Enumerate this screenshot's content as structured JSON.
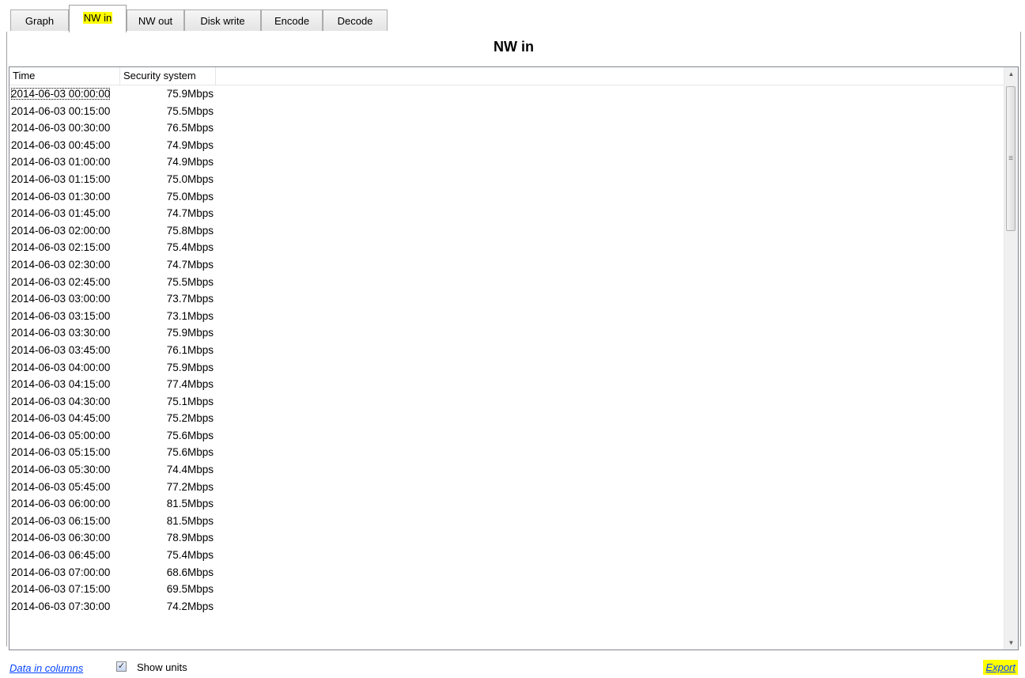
{
  "tabs": [
    {
      "label": "Graph"
    },
    {
      "label": "NW in"
    },
    {
      "label": "NW out"
    },
    {
      "label": "Disk write"
    },
    {
      "label": "Encode"
    },
    {
      "label": "Decode"
    }
  ],
  "active_tab": "NW in",
  "panel": {
    "title": "NW in"
  },
  "table": {
    "columns": [
      "Time",
      "Security system"
    ],
    "rows": [
      [
        "2014-06-03 00:00:00",
        "75.9Mbps"
      ],
      [
        "2014-06-03 00:15:00",
        "75.5Mbps"
      ],
      [
        "2014-06-03 00:30:00",
        "76.5Mbps"
      ],
      [
        "2014-06-03 00:45:00",
        "74.9Mbps"
      ],
      [
        "2014-06-03 01:00:00",
        "74.9Mbps"
      ],
      [
        "2014-06-03 01:15:00",
        "75.0Mbps"
      ],
      [
        "2014-06-03 01:30:00",
        "75.0Mbps"
      ],
      [
        "2014-06-03 01:45:00",
        "74.7Mbps"
      ],
      [
        "2014-06-03 02:00:00",
        "75.8Mbps"
      ],
      [
        "2014-06-03 02:15:00",
        "75.4Mbps"
      ],
      [
        "2014-06-03 02:30:00",
        "74.7Mbps"
      ],
      [
        "2014-06-03 02:45:00",
        "75.5Mbps"
      ],
      [
        "2014-06-03 03:00:00",
        "73.7Mbps"
      ],
      [
        "2014-06-03 03:15:00",
        "73.1Mbps"
      ],
      [
        "2014-06-03 03:30:00",
        "75.9Mbps"
      ],
      [
        "2014-06-03 03:45:00",
        "76.1Mbps"
      ],
      [
        "2014-06-03 04:00:00",
        "75.9Mbps"
      ],
      [
        "2014-06-03 04:15:00",
        "77.4Mbps"
      ],
      [
        "2014-06-03 04:30:00",
        "75.1Mbps"
      ],
      [
        "2014-06-03 04:45:00",
        "75.2Mbps"
      ],
      [
        "2014-06-03 05:00:00",
        "75.6Mbps"
      ],
      [
        "2014-06-03 05:15:00",
        "75.6Mbps"
      ],
      [
        "2014-06-03 05:30:00",
        "74.4Mbps"
      ],
      [
        "2014-06-03 05:45:00",
        "77.2Mbps"
      ],
      [
        "2014-06-03 06:00:00",
        "81.5Mbps"
      ],
      [
        "2014-06-03 06:15:00",
        "81.5Mbps"
      ],
      [
        "2014-06-03 06:30:00",
        "78.9Mbps"
      ],
      [
        "2014-06-03 06:45:00",
        "75.4Mbps"
      ],
      [
        "2014-06-03 07:00:00",
        "68.6Mbps"
      ],
      [
        "2014-06-03 07:15:00",
        "69.5Mbps"
      ],
      [
        "2014-06-03 07:30:00",
        "74.2Mbps"
      ]
    ]
  },
  "footer": {
    "data_in_columns_link": "Data in columns",
    "show_units_label": "Show units",
    "show_units_checked": true,
    "export_link": "Export"
  },
  "icons": {
    "scroll_up": "scroll-up-arrow-icon",
    "scroll_down": "scroll-down-arrow-icon",
    "checkbox_check": "checkmark-icon"
  },
  "colors": {
    "highlight": "#ffff00",
    "link": "#0645ff"
  }
}
